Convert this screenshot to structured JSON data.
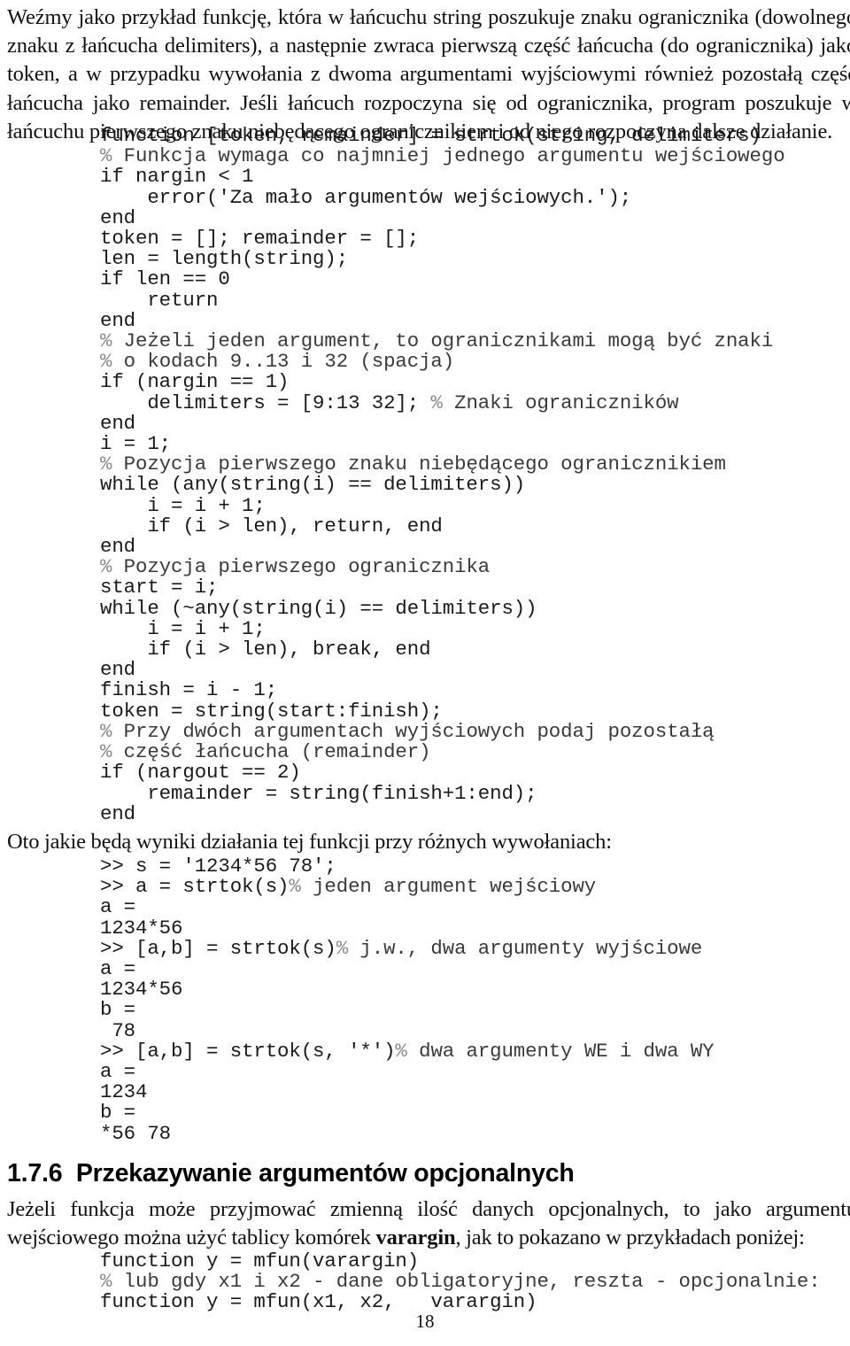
{
  "document": {
    "page_number": "18",
    "language": "pl"
  },
  "intro_paragraph": {
    "text": "Weźmy jako przykład funkcję, która w łańcuchu string poszukuje znaku ogranicznika (dowolnego znaku z łańcucha delimiters), a następnie zwraca pierwszą część łańcucha (do ogranicznika) jako token, a w przypadku wywołania z dwoma argumentami wyjściowymi również pozostałą część łańcucha jako remainder. Jeśli łańcuch rozpoczyna się od ogranicznika, program poszukuje w łańcuchu pierwszego znaku niebędącego ogranicznikiem i od niego rozpoczyna dalsze działanie."
  },
  "code_strtok": {
    "lines": [
      "function [token, remainder] = strtok(string, delimiters)",
      "% Funkcja wymaga co najmniej jednego argumentu wejściowego",
      "if nargin < 1",
      "    error('Za mało argumentów wejściowych.');",
      "end",
      "token = []; remainder = [];",
      "len = length(string);",
      "if len == 0",
      "    return",
      "end",
      "% Jeżeli jeden argument, to ogranicznikami mogą być znaki",
      "% o kodach 9..13 i 32 (spacja)",
      "if (nargin == 1)",
      "    delimiters = [9:13 32]; % Znaki ograniczników",
      "end",
      "i = 1;",
      "% Pozycja pierwszego znaku niebędącego ogranicznikiem",
      "while (any(string(i) == delimiters))",
      "    i = i + 1;",
      "    if (i > len), return, end",
      "end",
      "% Pozycja pierwszego ogranicznika",
      "start = i;",
      "while (~any(string(i) == delimiters))",
      "    i = i + 1;",
      "    if (i > len), break, end",
      "end",
      "finish = i - 1;",
      "token = string(start:finish);",
      "% Przy dwóch argumentach wyjściowych podaj pozostałą",
      "% część łańcucha (remainder)",
      "if (nargout == 2)",
      "    remainder = string(finish+1:end);",
      "end"
    ]
  },
  "results_paragraph": {
    "text": "Oto jakie będą wyniki działania tej funkcji przy różnych wywołaniach:"
  },
  "code_results": {
    "lines": [
      ">> s = '1234*56 78';",
      ">> a = strtok(s)% jeden argument wejściowy",
      "a =",
      "1234*56",
      ">> [a,b] = strtok(s)% j.w., dwa argumenty wyjściowe",
      "a =",
      "1234*56",
      "b =",
      " 78",
      ">> [a,b] = strtok(s, '*')% dwa argumenty WE i dwa WY",
      "a =",
      "1234",
      "b =",
      "*56 78"
    ]
  },
  "section": {
    "number": "1.7.6",
    "title": "Przekazywanie argumentów opcjonalnych",
    "heading_full": "1.7.6  Przekazywanie argumentów opcjonalnych"
  },
  "varargin_paragraph": {
    "part1": "Jeżeli funkcja może przyjmować zmienną ilość danych opcjonalnych, to jako argumentu wejściowego można użyć tablicy komórek ",
    "bold": "varargin",
    "part2": ", jak to pokazano w przykładach poniżej:"
  },
  "code_varargin": {
    "lines": [
      "function y = mfun(varargin)",
      "% lub gdy x1 i x2 - dane obligatoryjne, reszta - opcjonalnie:",
      "function y = mfun(x1, x2,   varargin)"
    ]
  }
}
